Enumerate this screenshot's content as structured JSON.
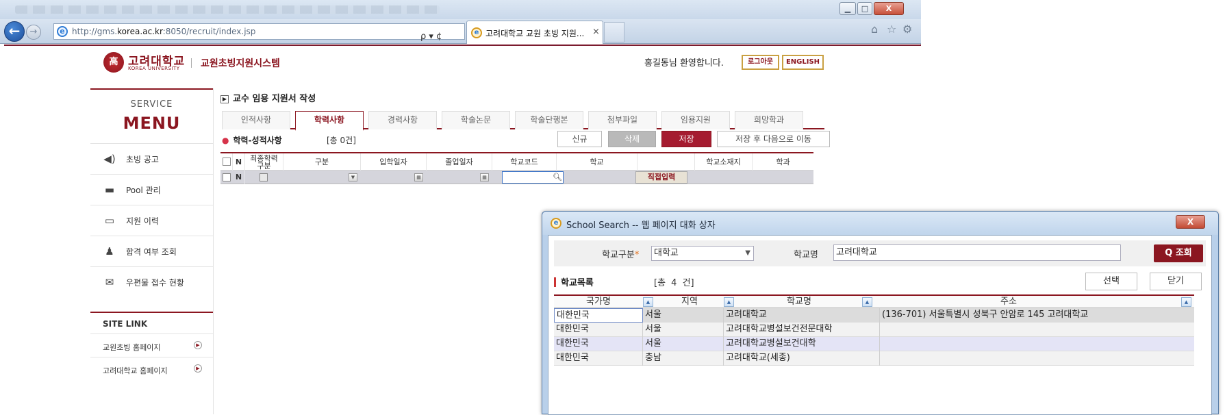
{
  "browser": {
    "url_prefix": "http://gms.",
    "url_host": "korea.ac.kr",
    "url_suffix": ":8050/recruit/index.jsp",
    "addr_tools": "ρ ▾ ¢",
    "tab_title": "고려대학교 교원 초빙 지원...",
    "tab_close": "×",
    "window_buttons": {
      "minimize": "▁",
      "maximize": "□",
      "close": "X"
    },
    "icons": [
      "home-icon",
      "star-icon",
      "gear-icon"
    ]
  },
  "header": {
    "logo_text": "高",
    "univ_name": "고려대학교",
    "univ_name_en": "KOREA UNIVERSITY",
    "system_title": "교원초빙지원시스템",
    "welcome": "홍길동님 환영합니다.",
    "logout_label": "로그아웃",
    "english_label": "ENGLISH"
  },
  "sidebar": {
    "service": "SERVICE",
    "menu": "MENU",
    "items": [
      {
        "label": "초빙 공고",
        "icon": "speaker-icon"
      },
      {
        "label": "Pool 관리",
        "icon": "laptop-icon"
      },
      {
        "label": "지원 이력",
        "icon": "document-icon"
      },
      {
        "label": "합격 여부 조회",
        "icon": "person-icon"
      },
      {
        "label": "우편물 접수 현황",
        "icon": "mail-icon"
      }
    ],
    "site_link_title": "SITE LINK",
    "links": [
      {
        "label": "교원초빙 홈페이지"
      },
      {
        "label": "고려대학교 홈페이지"
      }
    ]
  },
  "content": {
    "page_heading": "교수 임용 지원서 작성",
    "tabs": [
      "인적사항",
      "학력사항",
      "경력사항",
      "학술논문",
      "학술단행본",
      "첨부파일",
      "임용지원",
      "희망학과"
    ],
    "active_tab": "학력사항",
    "section_title": "학력-성적사항",
    "total_count": "[총    0건]",
    "buttons": {
      "new": "신규",
      "delete": "삭제",
      "save": "저장",
      "save_next": "저장 후 다음으로 이동"
    },
    "grid_headers": [
      "N",
      "최종학력\n구분",
      "구분",
      "입학일자",
      "졸업일자",
      "학교코드",
      "학교",
      "",
      "학교소재지",
      "학과"
    ],
    "row_marker": "N",
    "direct_input_label": "직접입력",
    "colors": {
      "accent": "#8b1620",
      "save_btn": "#a51c30",
      "delete_btn": "#b9b9b9"
    }
  },
  "dialog": {
    "title": "School Search -- 웹 페이지 대화 상자",
    "close_label": "X",
    "school_type_label": "학교구분",
    "required_mark": "*",
    "school_type_value": "대학교",
    "school_name_label": "학교명",
    "school_name_value": "고려대학교",
    "search_label": "Q 조회",
    "list_title": "학교목록",
    "list_count": "[총  4  건]",
    "select_label": "선택",
    "close_btn_label": "닫기",
    "columns": [
      "국가명",
      "지역",
      "학교명",
      "주소"
    ],
    "rows": [
      {
        "country": "대한민국",
        "region": "서울",
        "school": "고려대학교",
        "address": "(136-701) 서울특별시 성북구 안암로 145 고려대학교"
      },
      {
        "country": "대한민국",
        "region": "서울",
        "school": "고려대학교병설보건전문대학",
        "address": ""
      },
      {
        "country": "대한민국",
        "region": "서울",
        "school": "고려대학교병설보건대학",
        "address": ""
      },
      {
        "country": "대한민국",
        "region": "충남",
        "school": "고려대학교(세종)",
        "address": ""
      }
    ]
  }
}
